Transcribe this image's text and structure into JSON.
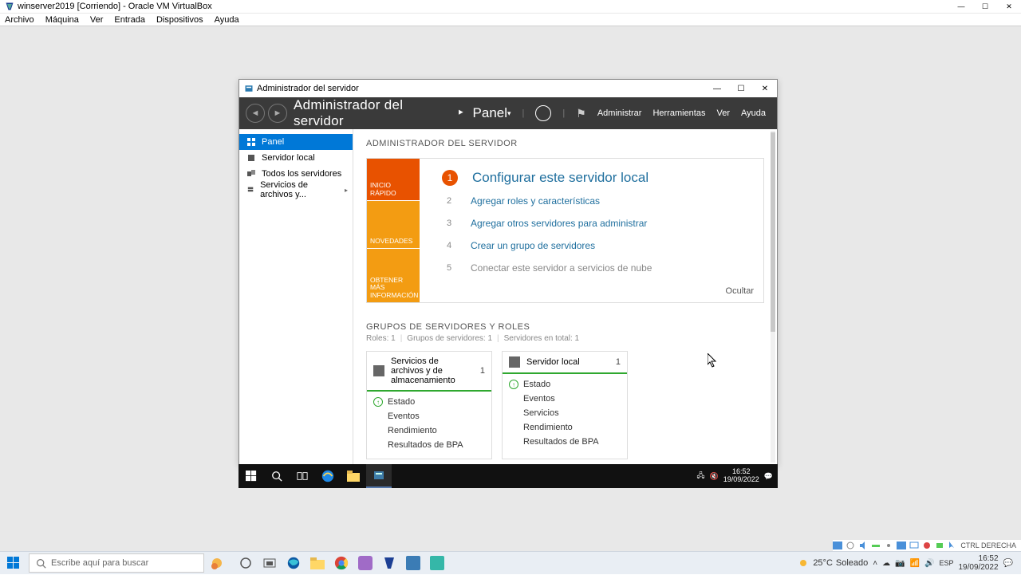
{
  "vbox": {
    "title": "winserver2019 [Corriendo] - Oracle VM VirtualBox",
    "menu": [
      "Archivo",
      "Máquina",
      "Ver",
      "Entrada",
      "Dispositivos",
      "Ayuda"
    ],
    "status_key": "CTRL DERECHA"
  },
  "server_manager": {
    "window_title": "Administrador del servidor",
    "header_title": "Administrador del servidor",
    "header_separator": "•",
    "header_sub": "Panel",
    "tools": {
      "manage": "Administrar",
      "tools_label": "Herramientas",
      "view": "Ver",
      "help": "Ayuda"
    },
    "sidebar": [
      {
        "label": "Panel",
        "active": true
      },
      {
        "label": "Servidor local",
        "active": false
      },
      {
        "label": "Todos los servidores",
        "active": false
      },
      {
        "label": "Servicios de archivos y...",
        "active": false,
        "has_sub": true
      }
    ],
    "dashboard_title": "ADMINISTRADOR DEL SERVIDOR",
    "welcome": {
      "tab1": "INICIO RÁPIDO",
      "tab2": "NOVEDADES",
      "tab3": "OBTENER MÁS INFORMACIÓN",
      "steps": [
        {
          "n": "1",
          "text": "Configurar este servidor local",
          "primary": true
        },
        {
          "n": "2",
          "text": "Agregar roles y características"
        },
        {
          "n": "3",
          "text": "Agregar otros servidores para administrar"
        },
        {
          "n": "4",
          "text": "Crear un grupo de servidores"
        },
        {
          "n": "5",
          "text": "Conectar este servidor a servicios de nube",
          "muted": true
        }
      ],
      "hide": "Ocultar"
    },
    "groups": {
      "title": "GRUPOS DE SERVIDORES Y ROLES",
      "sub_roles": "Roles: 1",
      "sub_groups": "Grupos de servidores: 1",
      "sub_total": "Servidores en total: 1"
    },
    "tiles": [
      {
        "title": "Servicios de archivos y de almacenamiento",
        "count": "1",
        "rows": [
          "Estado",
          "Eventos",
          "Rendimiento",
          "Resultados de BPA"
        ]
      },
      {
        "title": "Servidor local",
        "count": "1",
        "rows": [
          "Estado",
          "Eventos",
          "Servicios",
          "Rendimiento",
          "Resultados de BPA"
        ]
      }
    ]
  },
  "guest_taskbar": {
    "time": "16:52",
    "date": "19/09/2022"
  },
  "host": {
    "search_placeholder": "Escribe aquí para buscar",
    "weather_temp": "25°C",
    "weather_text": "Soleado",
    "time": "16:52",
    "date": "19/09/2022"
  }
}
